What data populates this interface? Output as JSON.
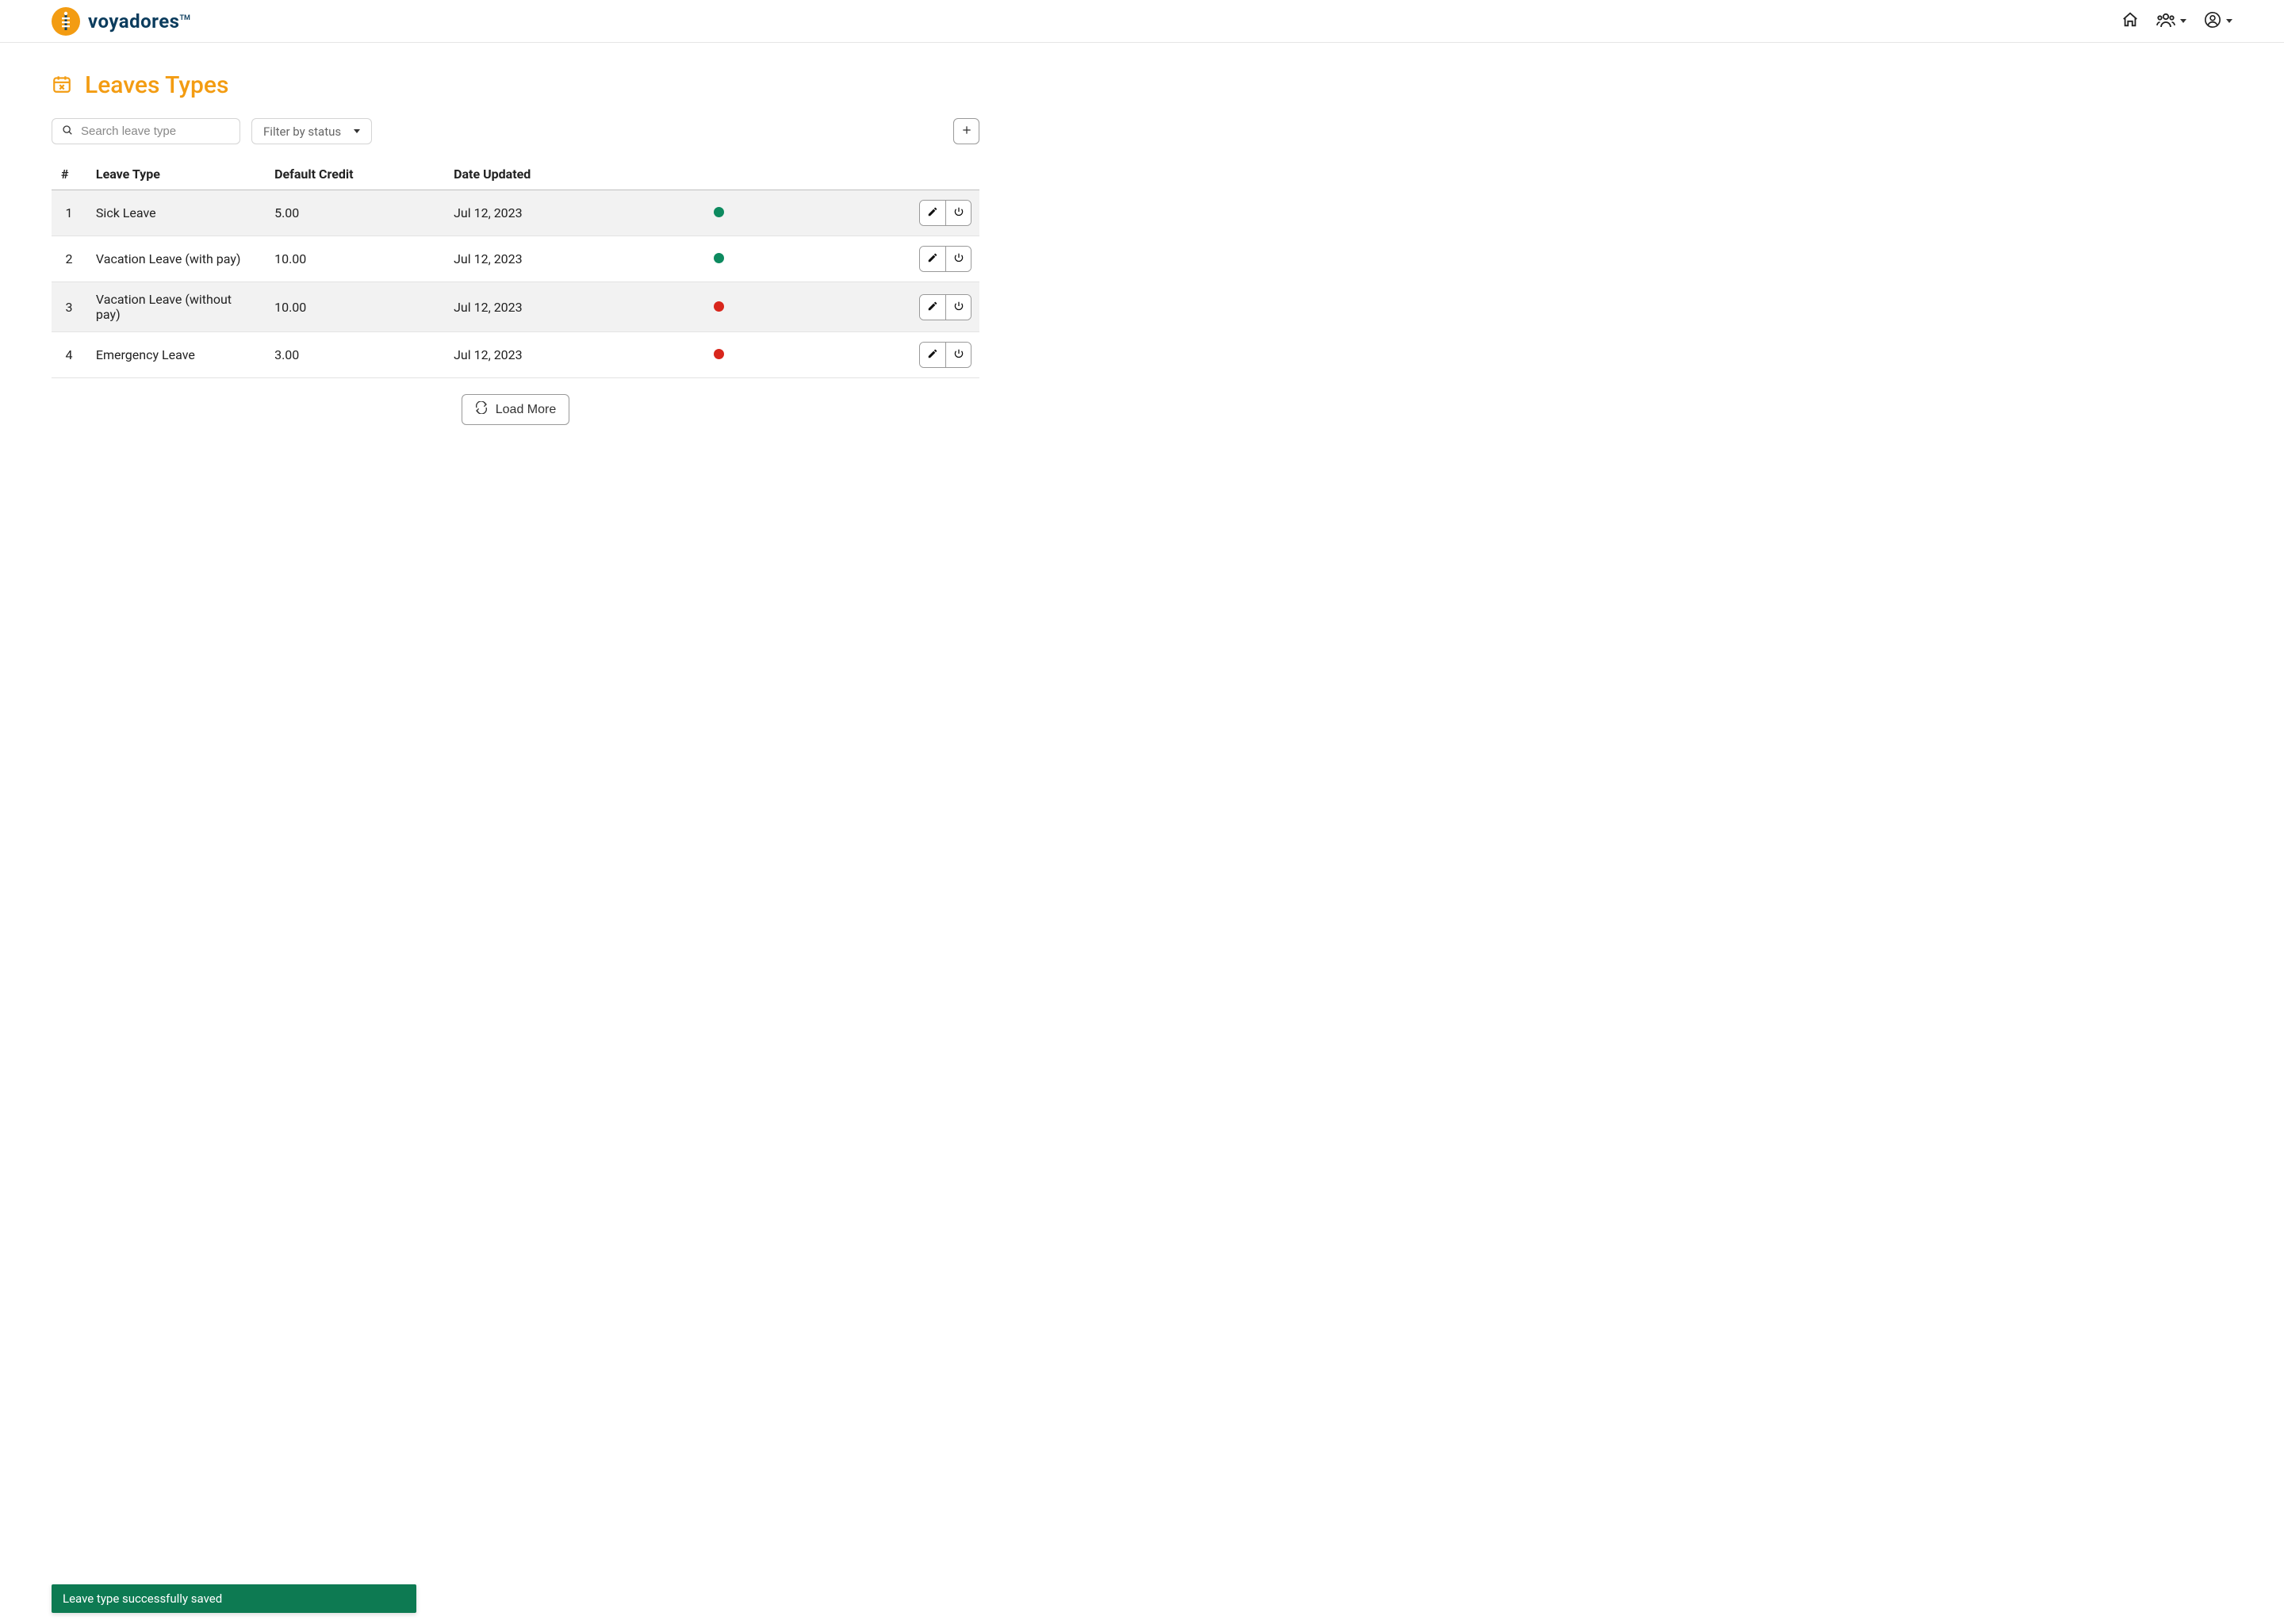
{
  "brand": {
    "name": "voyadores",
    "trademark": "TM"
  },
  "page": {
    "title": "Leaves Types",
    "search_placeholder": "Search leave type",
    "filter_label": "Filter by status",
    "load_more_label": "Load More"
  },
  "table": {
    "headers": {
      "num": "#",
      "type": "Leave Type",
      "credit": "Default Credit",
      "date": "Date Updated"
    },
    "rows": [
      {
        "num": "1",
        "type": "Sick Leave",
        "credit": "5.00",
        "date": "Jul 12, 2023",
        "status": "green"
      },
      {
        "num": "2",
        "type": "Vacation Leave (with pay)",
        "credit": "10.00",
        "date": "Jul 12, 2023",
        "status": "green"
      },
      {
        "num": "3",
        "type": "Vacation Leave (without pay)",
        "credit": "10.00",
        "date": "Jul 12, 2023",
        "status": "red"
      },
      {
        "num": "4",
        "type": "Emergency Leave",
        "credit": "3.00",
        "date": "Jul 12, 2023",
        "status": "red"
      }
    ]
  },
  "toast": {
    "message": "Leave type successfully saved"
  }
}
